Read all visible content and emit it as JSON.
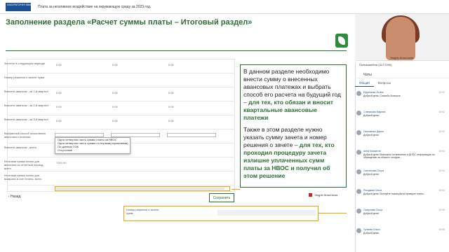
{
  "topbar": {
    "logo_text": "ЛАБОРАТОРИЯ КВАНТУМ",
    "doc_title": "Плата за негативное воздействие на окружающую среду за 2023 год."
  },
  "slide": {
    "title": "Заполнение раздела «Расчет суммы платы – Итоговый раздел»",
    "rows": [
      {
        "label": "Зачтено в следующем периоде",
        "v1": "0.00",
        "v2": "0.00",
        "v3": "0.00"
      },
      {
        "label": "Номер решения о зачете сумм",
        "v1": "",
        "v2": "",
        "v3": ""
      },
      {
        "label": "Внесено авансом - за 1-й квартал",
        "v1": "0.00",
        "v2": "0.00",
        "v3": "0.00"
      },
      {
        "label": "Внесено авансом - за 2-й квартал",
        "v1": "0.00",
        "v2": "0.00",
        "v3": "0.00"
      },
      {
        "label": "Внесено авансом - за 3-й квартал",
        "v1": "0.00",
        "v2": "0.00",
        "v3": "0.00"
      },
      {
        "label": "Выбранный способ исчисления авансового платежа",
        "v1": "",
        "v2": "",
        "v3": ""
      },
      {
        "label": "Внесено авансом - всего",
        "v1": "",
        "v2": "",
        "v3": ""
      },
      {
        "label": "Итоговая сумма платы для внесения за отчетный период, всего",
        "v1": "7000.00",
        "v2": "",
        "v3": ""
      },
      {
        "label": "Итоговая сумма платы для возврата в счет платы, всего",
        "v1": "",
        "v2": "",
        "v3": ""
      }
    ],
    "dropdown_options": [
      "Одна четвертая часть суммы платы за НВОС",
      "Одна четвертая часть суммы по нормам(нормативам)",
      "По данным ПЭК",
      "Отсутствие"
    ],
    "back_label": "‹ Назад",
    "save_label": "Сохранить",
    "info_p1_a": "В данном разделе необходимо внести сумму о внесенных авансовых платежах и выбрать способ его расчета на будущий год – ",
    "info_p1_b": "для тех, кто обязан и вносит квартальные авансовые платежи",
    "info_p2_a": "Также в этом разделе нужно указать сумму зачета и номер решения о зачете – ",
    "info_p2_b": "для тех, кто проходил процедуру зачета излишне уплаченных сумм платы за НВОС и получил об этом решение",
    "speaker_tag": "Эндрю Анастасия",
    "bottom_label": "Номер решения о зачете сумм"
  },
  "sidebar": {
    "video_name": "Эндрю Анастасия",
    "user_label": "Пользователи (317/7200)",
    "chats_label": "Чаты",
    "tabs": [
      "Общий",
      "Вопросы"
    ],
    "messages": [
      {
        "name": "Ефремова Лилия",
        "text": "Добрый день! Спасибо большое",
        "time": "10:02"
      },
      {
        "name": "Слепикова Марина",
        "text": "Добрый день!",
        "time": "10:02"
      },
      {
        "name": "Пахоменко Дарья",
        "text": "Добрый день!",
        "time": "10:02"
      },
      {
        "name": "Анна Клименте",
        "text": "Добрый день! Возможно ли внесение в ДНОС информации по обращению за объекте отходов...",
        "time": "10:03"
      },
      {
        "name": "Смоленова Ольга",
        "text": "Добрый день!",
        "time": "10:04"
      },
      {
        "name": "Рекодина Ольга",
        "text": "Добрый день! Волнуйте пожалуйста проверке платы...",
        "time": "10:04"
      },
      {
        "name": "Смирнова Ольга",
        "text": "Добрый день!",
        "time": "10:05"
      },
      {
        "name": "Гуляевя Ольга",
        "text": "Добрый день!",
        "time": "10:05"
      }
    ]
  }
}
